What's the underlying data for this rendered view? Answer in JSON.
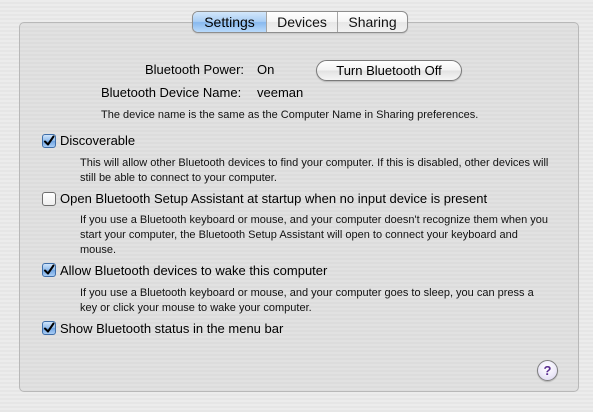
{
  "tabs": [
    {
      "label": "Settings",
      "selected": true
    },
    {
      "label": "Devices",
      "selected": false
    },
    {
      "label": "Sharing",
      "selected": false
    }
  ],
  "power": {
    "label": "Bluetooth Power:",
    "value": "On",
    "button_label": "Turn Bluetooth Off"
  },
  "device_name": {
    "label": "Bluetooth Device Name:",
    "value": "veeman",
    "note": "The device name is the same as the Computer Name in Sharing preferences."
  },
  "options": [
    {
      "label": "Discoverable",
      "checked": true,
      "description": "This will allow other Bluetooth devices to find your computer.  If this is disabled, other devices will still be able to connect to your computer."
    },
    {
      "label": "Open Bluetooth Setup Assistant at startup when no input device is present",
      "checked": false,
      "description": "If you use a Bluetooth keyboard or mouse, and your computer doesn't recognize them when you start your computer, the Bluetooth Setup Assistant will open to connect your keyboard and mouse."
    },
    {
      "label": "Allow Bluetooth devices to wake this computer",
      "checked": true,
      "description": "If you use a Bluetooth keyboard or mouse, and your computer goes to sleep, you can press a key or click your mouse to wake your computer."
    },
    {
      "label": "Show Bluetooth status in the menu bar",
      "checked": true
    }
  ],
  "help": {
    "label": "?"
  },
  "icons": {
    "checkmark": "checkmark-icon",
    "help": "help-icon"
  },
  "colors": {
    "selected_tab": "#a9cdf4",
    "checkbox_checked": "#8fbaeb",
    "help_glyph": "#5a2d91"
  }
}
